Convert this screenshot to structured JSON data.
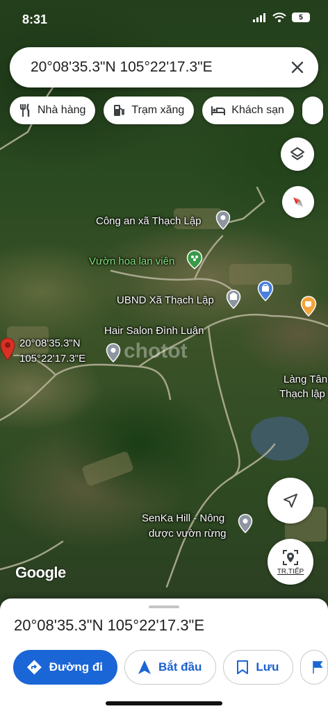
{
  "status_bar": {
    "time": "8:31",
    "battery": "5"
  },
  "search": {
    "query": "20°08'35.3\"N 105°22'17.3\"E"
  },
  "chips": [
    {
      "label": "Nhà hàng",
      "icon": "restaurant-icon"
    },
    {
      "label": "Trạm xăng",
      "icon": "gas-station-icon"
    },
    {
      "label": "Khách sạn",
      "icon": "hotel-icon"
    }
  ],
  "map": {
    "labels": {
      "police": "Công an xã Thạch Lập",
      "garden": "Vườn hoa lan viên",
      "ubnd": "UBND Xã Thạch Lập",
      "salon": "Hair Salon Đình Luân",
      "pin_lat": "20°08'35.3\"N",
      "pin_lng": "105°22'17.3\"E",
      "village_1": "Làng Tân",
      "village_2": "Thạch lập",
      "senka_1": "SenKa Hill - Nông",
      "senka_2": "dược vườn rừng"
    },
    "watermark": "chotot",
    "google": "Google",
    "next_label": "TR.TIẾP"
  },
  "sheet": {
    "title": "20°08'35.3\"N 105°22'17.3\"E",
    "directions": "Đường đi",
    "start": "Bắt đầu",
    "save": "Lưu"
  },
  "colors": {
    "accent": "#1a66d6",
    "pin_red": "#d93025",
    "place_green": "#7fe07a",
    "shopping_blue": "#4a7fe0",
    "cafe_orange": "#f2a33a"
  }
}
